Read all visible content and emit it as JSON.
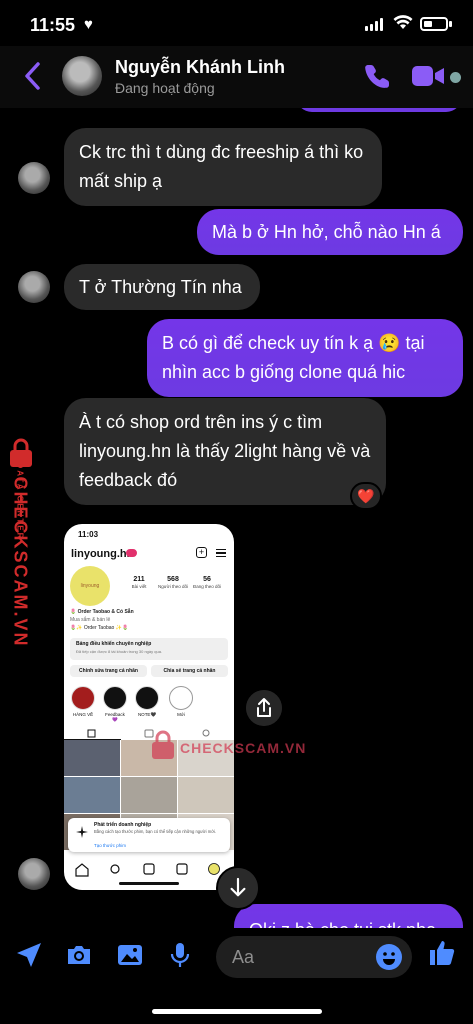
{
  "status_bar": {
    "time": "11:55",
    "heart": "♥"
  },
  "header": {
    "contact_name": "Nguyễn Khánh Linh",
    "status": "Đang hoạt động"
  },
  "messages": [
    {
      "side": "in",
      "text": "Ck trc thì t dùng đc freeship á thì ko mất ship ạ"
    },
    {
      "side": "out",
      "text": "Mà b ở Hn hở, chỗ nào Hn á"
    },
    {
      "side": "in",
      "text": "T ở Thường Tín nha"
    },
    {
      "side": "out",
      "text": "B có gì để check uy tín k ạ 😢 tại nhìn acc b giống clone quá hic"
    },
    {
      "side": "in",
      "text": "À t có shop ord trên ins ý c tìm linyoung.hn là thấy 2light hàng về và feedback đó",
      "reaction": "❤️"
    },
    {
      "side": "out",
      "text": "Oki z bà cho tui stk nha"
    }
  ],
  "shared_screenshot": {
    "time": "11:03",
    "handle": "linyoung.hn",
    "avatar_text": "linyoung",
    "stats": [
      {
        "value": "211",
        "label": "Bài viết"
      },
      {
        "value": "568",
        "label": "Người theo dõi"
      },
      {
        "value": "56",
        "label": "Đang theo dõi"
      }
    ],
    "bio_lines": [
      "🌷 Order Taobao & Có Sẵn",
      "Mua sắm & bán lẻ",
      "🌷✨ Order Taobao ✨🌷"
    ],
    "dashboard_title": "Bảng điều khiển chuyên nghiệp",
    "dashboard_sub": "Đã tiếp cận được 8 tài khoản trong 30 ngày qua.",
    "btn_edit": "Chỉnh sửa trang cá nhân",
    "btn_share": "Chia sẻ trang cá nhân",
    "highlights": [
      "HÀNG VỀ",
      "Feedback 💜",
      "NOTE🖤",
      "Mới"
    ],
    "toast_title": "Phát triển doanh nghiệp",
    "toast_body": "Bằng cách tạo thước phim, bạn có thể tiếp cận những người mới.",
    "toast_link": "Tạo thước phim"
  },
  "watermark": {
    "brand": "CHECKSCAM.VN",
    "sub": "DATA CENTER"
  },
  "composer": {
    "placeholder": "Aa"
  },
  "colors": {
    "accent": "#7c3aed",
    "incoming": "#2a2a2a",
    "header_icons": "#8b5cf6",
    "composer_icons": "#4f8cff"
  }
}
